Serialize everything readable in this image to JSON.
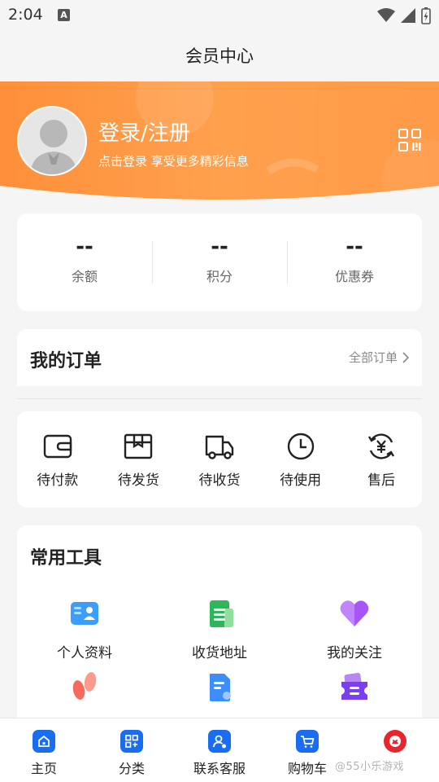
{
  "status_bar": {
    "time": "2:04",
    "notification_badge": "A"
  },
  "header": {
    "title": "会员中心"
  },
  "profile": {
    "login_title": "登录/注册",
    "login_subtitle": "点击登录 享受更多精彩信息",
    "accent_color": "#ff8a3d"
  },
  "stats": [
    {
      "value": "--",
      "label": "余额"
    },
    {
      "value": "--",
      "label": "积分"
    },
    {
      "value": "--",
      "label": "优惠券"
    }
  ],
  "orders": {
    "title": "我的订单",
    "all_orders_label": "全部订单",
    "items": [
      {
        "label": "待付款",
        "icon": "wallet-icon"
      },
      {
        "label": "待发货",
        "icon": "package-icon"
      },
      {
        "label": "待收货",
        "icon": "truck-icon"
      },
      {
        "label": "待使用",
        "icon": "clock-icon"
      },
      {
        "label": "售后",
        "icon": "yen-refund-icon"
      }
    ]
  },
  "tools": {
    "title": "常用工具",
    "items": [
      {
        "label": "个人资料",
        "icon": "id-card-icon"
      },
      {
        "label": "收货地址",
        "icon": "address-icon"
      },
      {
        "label": "我的关注",
        "icon": "heart-icon"
      },
      {
        "label": "",
        "icon": "footprint-icon"
      },
      {
        "label": "",
        "icon": "document-icon"
      },
      {
        "label": "",
        "icon": "ticket-icon"
      }
    ]
  },
  "bottom_nav": [
    {
      "label": "主页",
      "icon": "home-icon"
    },
    {
      "label": "分类",
      "icon": "category-icon"
    },
    {
      "label": "联系客服",
      "icon": "service-icon"
    },
    {
      "label": "购物车",
      "icon": "cart-icon"
    },
    {
      "label": "",
      "icon": "member-icon"
    }
  ],
  "watermark": "@55小乐游戏",
  "colors": {
    "nav_blue": "#1a6cf0",
    "nav_red": "#e8242c",
    "orange": "#ff8a3d"
  }
}
